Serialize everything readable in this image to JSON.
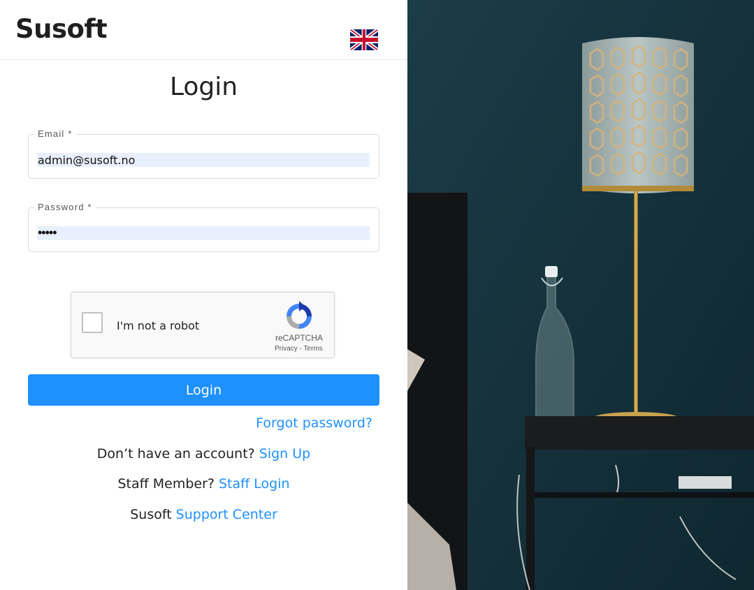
{
  "header": {
    "logo": "Susoft",
    "language_flag": "uk-flag-icon"
  },
  "form": {
    "title": "Login",
    "email_label": "Email *",
    "email_value": "admin@susoft.no",
    "password_label": "Password *",
    "password_masked": "•••••",
    "submit_label": "Login"
  },
  "captcha": {
    "checkbox_label": "I'm not a robot",
    "brand": "reCAPTCHA",
    "privacy": "Privacy",
    "separator": " - ",
    "terms": "Terms"
  },
  "links": {
    "forgot_password": "Forgot password?",
    "signup_prompt": "Don’t have an account?",
    "signup_link": "Sign Up",
    "staff_prompt": "Staff Member?",
    "staff_link": "Staff Login",
    "support_prompt": "Susoft",
    "support_link": "Support Center"
  },
  "colors": {
    "accent": "#1e90ff",
    "wall": "#15323d"
  }
}
